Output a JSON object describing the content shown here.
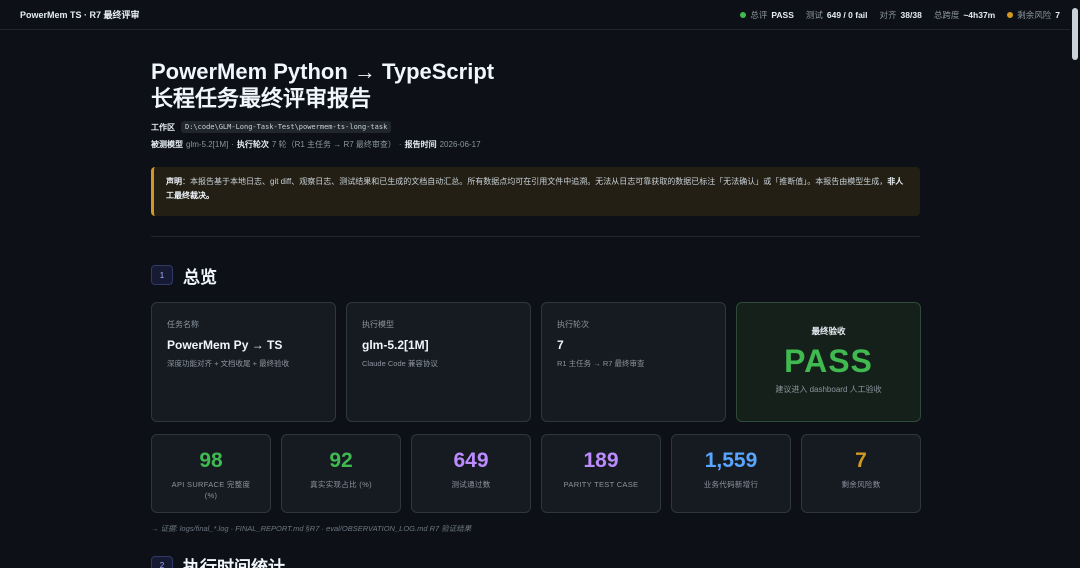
{
  "topbar": {
    "brand": "PowerMem TS · R7 最终评审",
    "stats": [
      {
        "dot": "green",
        "label": "总评",
        "value": "PASS"
      },
      {
        "dot": "",
        "label": "测试",
        "value": "649 / 0 fail"
      },
      {
        "dot": "",
        "label": "对齐",
        "value": "38/38"
      },
      {
        "dot": "",
        "label": "总跨度",
        "value": "~4h37m"
      },
      {
        "dot": "amber",
        "label": "剩余风险",
        "value": "7"
      }
    ]
  },
  "header": {
    "title_line1": "PowerMem Python → TypeScript",
    "title_line2": "长程任务最终评审报告",
    "workspace_label": "工作区",
    "workspace_path": "D:\\code\\GLM-Long-Task-Test\\powermem-ts-long-task",
    "model_label": "被测模型",
    "model_value": "glm-5.2[1M]",
    "rounds_label": "执行轮次",
    "rounds_value": "7 轮（R1 主任务 → R7 最终审查）",
    "time_label": "报告时间",
    "time_value": "2026-06-17"
  },
  "notice": {
    "label": "声明",
    "text": "：本报告基于本地日志、git diff、观察日志、测试结果和已生成的文档自动汇总。所有数据点均可在引用文件中追溯。无法从日志可靠获取的数据已标注「无法确认」或「推断值」。本报告由模型生成，",
    "emphasis": "非人工最终裁决。"
  },
  "section1": {
    "num": "1",
    "title": "总览"
  },
  "cards": [
    {
      "label": "任务名称",
      "value": "PowerMem Py → TS",
      "sub": "深度功能对齐 + 文档收尾 + 最终验收"
    },
    {
      "label": "执行模型",
      "value": "glm-5.2[1M]",
      "sub": "Claude Code 兼容协议"
    },
    {
      "label": "执行轮次",
      "value": "7",
      "sub": "R1 主任务 → R7 最终审查"
    }
  ],
  "final_card": {
    "label": "最终验收",
    "value": "PASS",
    "sub": "建议进入 dashboard 人工验收"
  },
  "metrics": [
    {
      "value": "98",
      "label": "API SURFACE 完整度 (%)",
      "color": "#3fb950"
    },
    {
      "value": "92",
      "label": "真实实现占比 (%)",
      "color": "#3fb950"
    },
    {
      "value": "649",
      "label": "测试通过数",
      "color": "#bc8cff"
    },
    {
      "value": "189",
      "label": "PARITY TEST CASE",
      "color": "#bc8cff"
    },
    {
      "value": "1,559",
      "label": "业务代码新增行",
      "color": "#58a6ff"
    },
    {
      "value": "7",
      "label": "剩余风险数",
      "color": "#d29922"
    }
  ],
  "evidence": "→ 证据: logs/final_*.log · FINAL_REPORT.md §R7 · eval/OBSERVATION_LOG.md R7 验证结果",
  "section2": {
    "num": "2",
    "title": "执行时间统计"
  }
}
